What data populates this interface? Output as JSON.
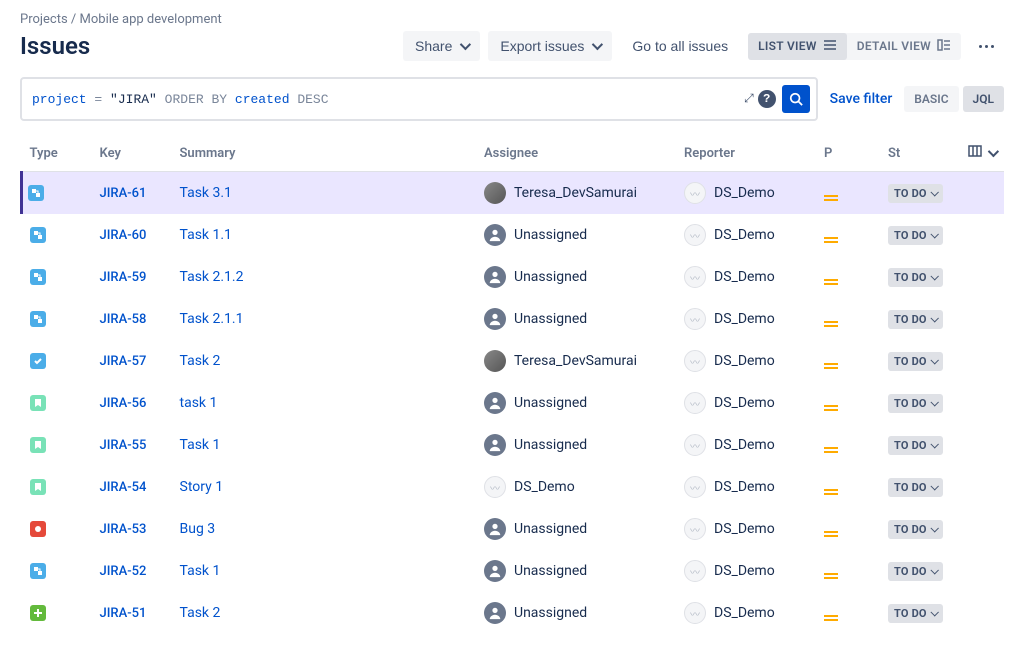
{
  "breadcrumb": {
    "root": "Projects",
    "project": "Mobile app development",
    "separator": "/"
  },
  "page_title": "Issues",
  "toolbar": {
    "share": "Share",
    "export": "Export issues",
    "go_to_all": "Go to all issues",
    "list_view": "LIST VIEW",
    "detail_view": "DETAIL VIEW"
  },
  "search": {
    "jql": {
      "field": "project",
      "eq": "=",
      "value": "\"JIRA\"",
      "orderby": "ORDER BY",
      "sortfield": "created",
      "dir": "DESC"
    },
    "save_filter": "Save filter",
    "basic": "BASIC",
    "jql_btn": "JQL"
  },
  "columns": {
    "type": "Type",
    "key": "Key",
    "summary": "Summary",
    "assignee": "Assignee",
    "reporter": "Reporter",
    "p": "P",
    "status": "St"
  },
  "status_label": "TO DO",
  "issues": [
    {
      "type": "subtask",
      "key": "JIRA-61",
      "summary": "Task 3.1",
      "assignee": "Teresa_DevSamurai",
      "assignee_kind": "user",
      "reporter": "DS_Demo",
      "priority": "medium",
      "selected": true
    },
    {
      "type": "subtask",
      "key": "JIRA-60",
      "summary": "Task 1.1",
      "assignee": "Unassigned",
      "assignee_kind": "unassigned",
      "reporter": "DS_Demo",
      "priority": "medium",
      "selected": false
    },
    {
      "type": "subtask",
      "key": "JIRA-59",
      "summary": "Task 2.1.2",
      "assignee": "Unassigned",
      "assignee_kind": "unassigned",
      "reporter": "DS_Demo",
      "priority": "medium",
      "selected": false
    },
    {
      "type": "subtask",
      "key": "JIRA-58",
      "summary": "Task 2.1.1",
      "assignee": "Unassigned",
      "assignee_kind": "unassigned",
      "reporter": "DS_Demo",
      "priority": "medium",
      "selected": false
    },
    {
      "type": "task",
      "key": "JIRA-57",
      "summary": "Task 2",
      "assignee": "Teresa_DevSamurai",
      "assignee_kind": "user",
      "reporter": "DS_Demo",
      "priority": "medium",
      "selected": false
    },
    {
      "type": "newfeat",
      "key": "JIRA-56",
      "summary": "task 1",
      "assignee": "Unassigned",
      "assignee_kind": "unassigned",
      "reporter": "DS_Demo",
      "priority": "medium",
      "selected": false
    },
    {
      "type": "newfeat",
      "key": "JIRA-55",
      "summary": "Task 1",
      "assignee": "Unassigned",
      "assignee_kind": "unassigned",
      "reporter": "DS_Demo",
      "priority": "medium",
      "selected": false
    },
    {
      "type": "story",
      "key": "JIRA-54",
      "summary": "Story 1",
      "assignee": "DS_Demo",
      "assignee_kind": "demo",
      "reporter": "DS_Demo",
      "priority": "medium",
      "selected": false
    },
    {
      "type": "bug",
      "key": "JIRA-53",
      "summary": "Bug 3",
      "assignee": "Unassigned",
      "assignee_kind": "unassigned",
      "reporter": "DS_Demo",
      "priority": "medium",
      "selected": false
    },
    {
      "type": "subtask",
      "key": "JIRA-52",
      "summary": "Task 1",
      "assignee": "Unassigned",
      "assignee_kind": "unassigned",
      "reporter": "DS_Demo",
      "priority": "medium",
      "selected": false
    },
    {
      "type": "improve",
      "key": "JIRA-51",
      "summary": "Task 2",
      "assignee": "Unassigned",
      "assignee_kind": "unassigned",
      "reporter": "DS_Demo",
      "priority": "medium",
      "selected": false
    }
  ],
  "type_icon_titles": {
    "subtask": "Sub-task",
    "task": "Task",
    "newfeat": "New Feature",
    "story": "Story",
    "bug": "Bug",
    "improve": "Improvement"
  }
}
